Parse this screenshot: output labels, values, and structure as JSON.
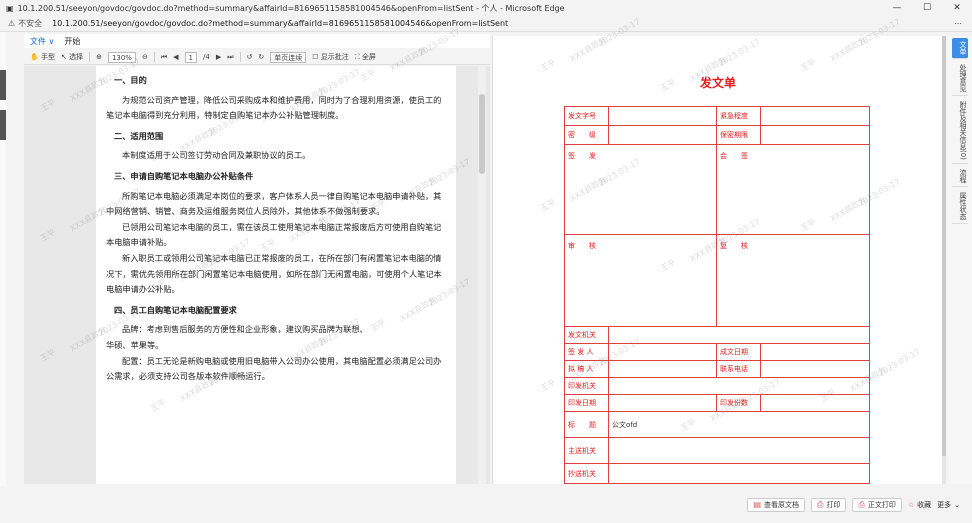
{
  "browser": {
    "title": "10.1.200.51/seeyon/govdoc/govdoc.do?method=summary&affairId=8169651158581004546&openFrom=listSent - 个人 - Microsoft Edge",
    "security": "不安全",
    "url": "10.1.200.51/seeyon/govdoc/govdoc.do?method=summary&affairId=8169651158581004546&openFrom=listSent",
    "minimize": "—",
    "maximize": "☐",
    "close": "✕",
    "more": "⋯"
  },
  "menu": {
    "file": "文件 ∨",
    "start": "开始"
  },
  "toolbar": {
    "hand": "手型",
    "select": "选择",
    "zoom": "130%",
    "page_current": "1",
    "page_total": "/4",
    "mode": "单页连续",
    "show_annot": "显示批注",
    "full": "全屏"
  },
  "document": {
    "p1_heading": "一、目的",
    "p1_body": "为规范公司资产管理，降低公司采购成本和维护费用，同时为了合理利用资源，使员工的笔记本电脑得到充分利用，特制定自购笔记本办公补贴管理制度。",
    "p2_heading": "二、适用范围",
    "p2_body": "本制度适用于公司签订劳动合同及兼职协议的员工。",
    "p3_heading": "三、申请自购笔记本电脑办公补贴条件",
    "p3_body1": "所购笔记本电脑必须满足本岗位的要求，客户体系人员一律自购笔记本电脑申请补贴，其中网络营销、销管、商务及运维服务岗位人员除外，其他体系不做强制要求。",
    "p3_body2": "已领用公司笔记本电脑的员工，需在该员工使用笔记本电脑正常报废后方可使用自购笔记本电脑申请补贴。",
    "p3_body3": "新入职员工或领用公司笔记本电脑已正常报废的员工，在所在部门有闲置笔记本电脑的情况下，需优先领用所在部门闲置笔记本电脑使用，如所在部门无闲置电脑，可使用个人笔记本电脑申请办公补贴。",
    "p4_heading": "四、员工自购笔记本电脑配置要求",
    "p4_body1": "品牌：考虑到售后服务的方便性和企业形象，建议购买品牌为联想、",
    "p4_body2": "华硕、苹果等。",
    "p4_body3": "配置：员工无论是新购电脑或使用旧电脑带入公司办公使用，其电脑配置必须满足公司办公需求，必须支持公司各版本软件顺畅运行。"
  },
  "watermark": {
    "name": "王平",
    "org": "XXX县政务",
    "date": "2023-03-17"
  },
  "form": {
    "title": "发文单",
    "doc_number": "发文字号",
    "urgency": "紧急程度",
    "secret": "密　　级",
    "secret_period": "保密期限",
    "sign": "签　　发",
    "countersign": "会　　签",
    "review": "审　　核",
    "recheck": "复　　核",
    "issuing_org": "发文机关",
    "signer": "签 发 人",
    "date_formed": "成文日期",
    "drafter": "拟 稿 人",
    "phone": "联系电话",
    "print_org": "印发机关",
    "print_date": "印发日期",
    "print_copies": "印发份数",
    "subject": "标　　题",
    "subject_value": "公文ofd",
    "main_to": "主送机关",
    "cc_to": "抄送机关"
  },
  "sidetabs": [
    "文单",
    "处理意见",
    "附件及相关信息(0)",
    "流程",
    "属性状态"
  ],
  "bottom": {
    "view_doc": "查看原文档",
    "print": "打印",
    "print_body": "正文打印",
    "favorite": "收藏",
    "more": "更多"
  }
}
